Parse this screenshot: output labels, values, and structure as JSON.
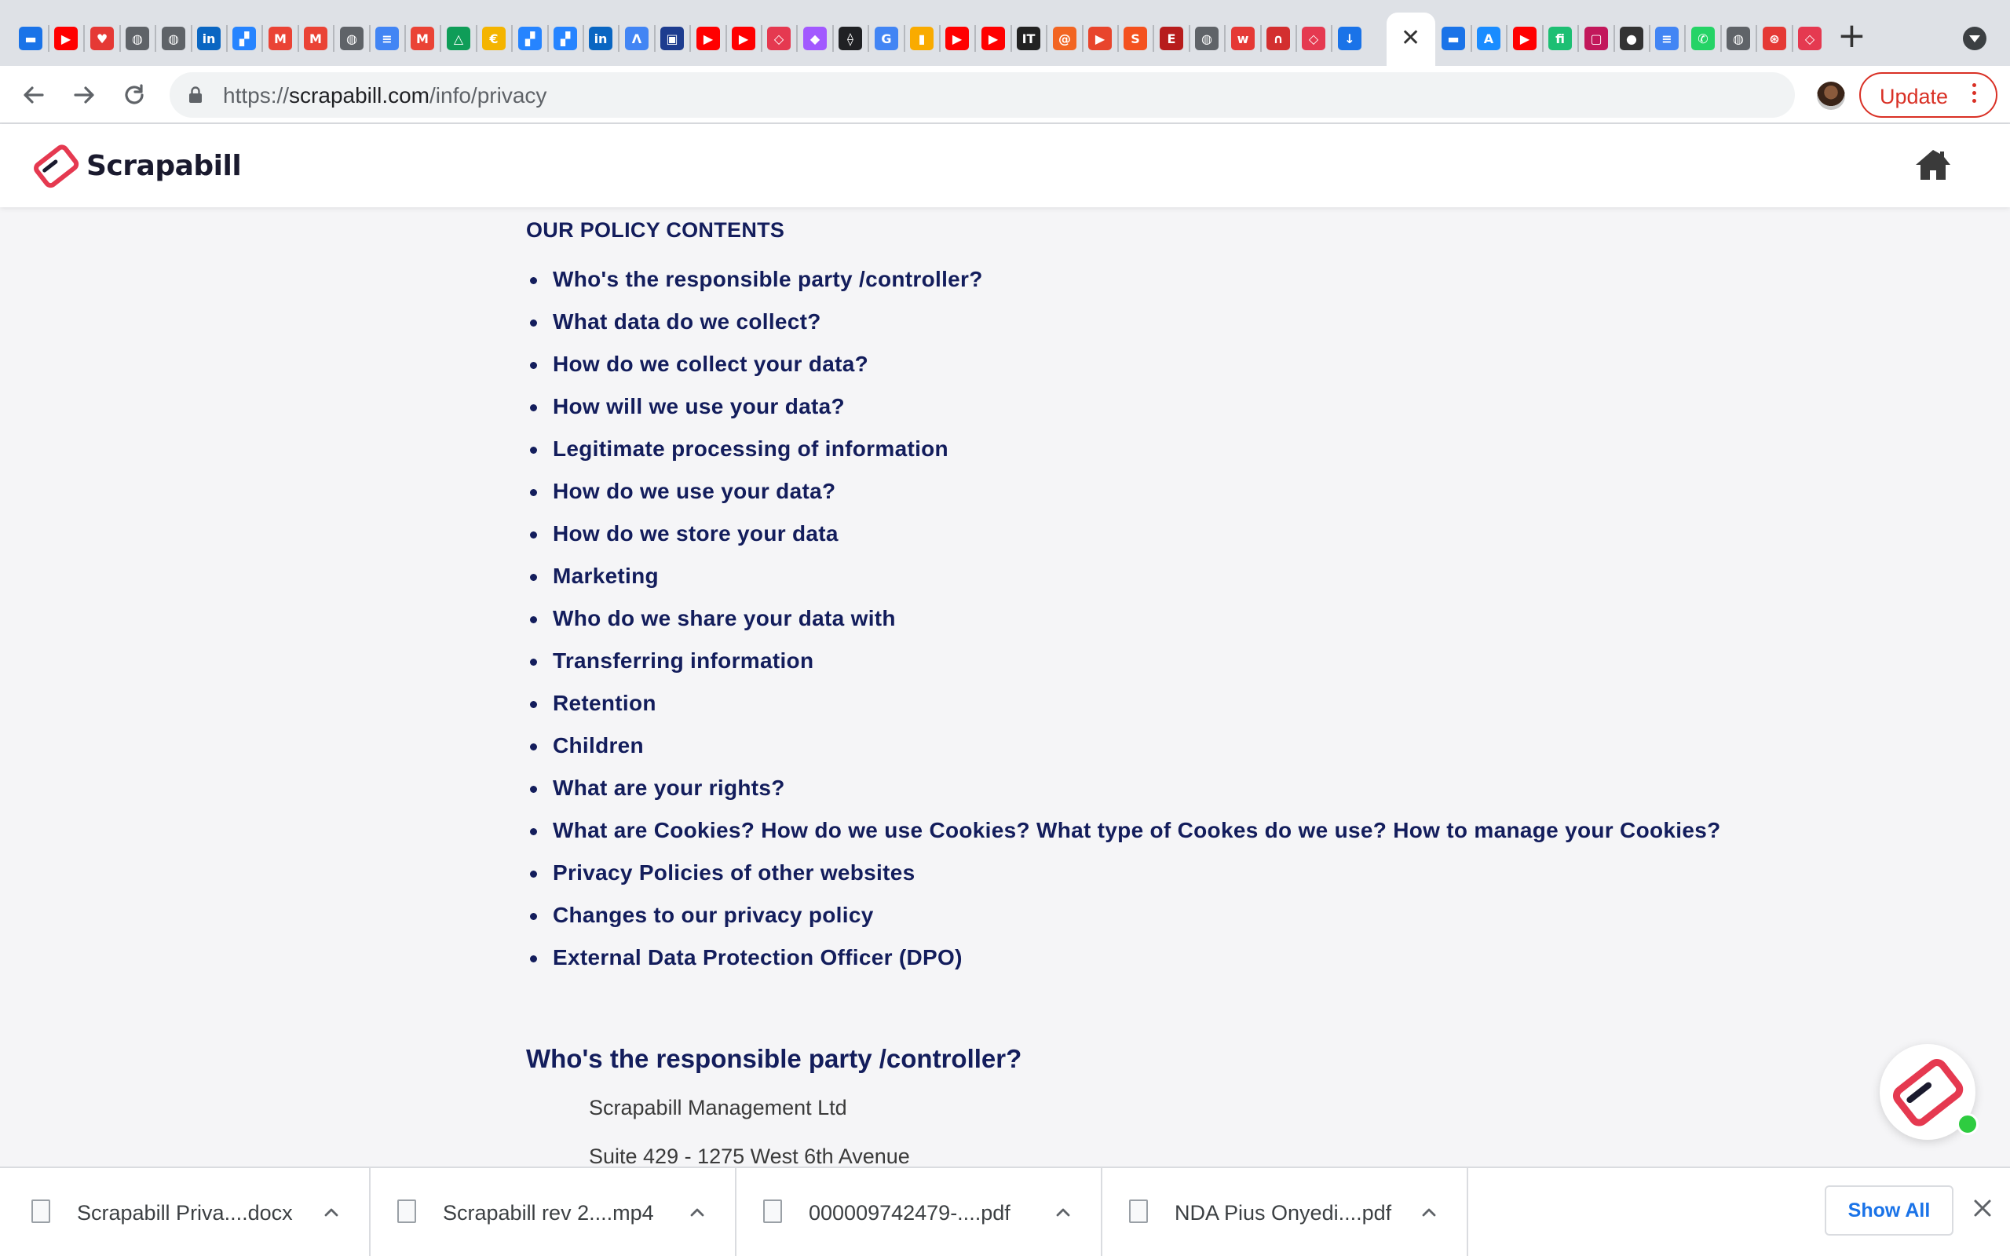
{
  "browser": {
    "tabs": [
      {
        "icon": "chat-icon",
        "color": "#1a73e8"
      },
      {
        "icon": "youtube-icon",
        "color": "#ff0000"
      },
      {
        "icon": "heart-icon",
        "color": "#e53935"
      },
      {
        "icon": "globe-icon",
        "color": "#5f6368"
      },
      {
        "icon": "globe-icon",
        "color": "#5f6368"
      },
      {
        "icon": "linkedin-icon",
        "color": "#0a66c2"
      },
      {
        "icon": "confluence-icon",
        "color": "#2684ff"
      },
      {
        "icon": "gmail-icon",
        "color": "#ea4335"
      },
      {
        "icon": "gmail-icon",
        "color": "#ea4335"
      },
      {
        "icon": "globe-icon",
        "color": "#5f6368"
      },
      {
        "icon": "document-icon",
        "color": "#4285f4"
      },
      {
        "icon": "gmail-icon",
        "color": "#ea4335"
      },
      {
        "icon": "google-drive-icon",
        "color": "#0f9d58"
      },
      {
        "icon": "coin-icon",
        "color": "#f4b400"
      },
      {
        "icon": "confluence-icon",
        "color": "#2684ff"
      },
      {
        "icon": "confluence-icon",
        "color": "#2684ff"
      },
      {
        "icon": "linkedin-icon",
        "color": "#0a66c2"
      },
      {
        "icon": "google-ads-icon",
        "color": "#4285f4"
      },
      {
        "icon": "bank-icon",
        "color": "#1d3c8f"
      },
      {
        "icon": "youtube-icon",
        "color": "#ff0000"
      },
      {
        "icon": "youtube-icon",
        "color": "#ff0000"
      },
      {
        "icon": "scrapabill-icon",
        "color": "#e53950"
      },
      {
        "icon": "figma-icon",
        "color": "#a259ff"
      },
      {
        "icon": "pen-icon",
        "color": "#202124"
      },
      {
        "icon": "google-icon",
        "color": "#4285f4"
      },
      {
        "icon": "analytics-icon",
        "color": "#f9ab00"
      },
      {
        "icon": "youtube-icon",
        "color": "#ff0000"
      },
      {
        "icon": "youtube-icon",
        "color": "#ff0000"
      },
      {
        "icon": "itpro-icon",
        "color": "#222222"
      },
      {
        "icon": "spiral-icon",
        "color": "#f26522"
      },
      {
        "icon": "bookmark-icon",
        "color": "#e8452c"
      },
      {
        "icon": "s-icon",
        "color": "#f4511e"
      },
      {
        "icon": "evs-icon",
        "color": "#b71c1c"
      },
      {
        "icon": "globe-icon",
        "color": "#5f6368"
      },
      {
        "icon": "w-icon",
        "color": "#e53935"
      },
      {
        "icon": "arc-icon",
        "color": "#d32f2f"
      },
      {
        "icon": "scrapabill-icon",
        "color": "#e53950"
      },
      {
        "icon": "download-icon",
        "color": "#1a73e8"
      },
      {
        "icon": "chat-icon",
        "color": "#1a73e8"
      },
      {
        "icon": "app-store-icon",
        "color": "#1a8cff"
      },
      {
        "icon": "youtube-icon",
        "color": "#ff0000"
      },
      {
        "icon": "fiverr-icon",
        "color": "#1dbf73"
      },
      {
        "icon": "screen-icon",
        "color": "#c2185b"
      },
      {
        "icon": "badge-icon",
        "color": "#333333"
      },
      {
        "icon": "document-icon",
        "color": "#4285f4"
      },
      {
        "icon": "whatsapp-icon",
        "color": "#25d366"
      },
      {
        "icon": "globe-icon",
        "color": "#5f6368"
      },
      {
        "icon": "target-icon",
        "color": "#e53935"
      },
      {
        "icon": "scrapabill-icon",
        "color": "#e53950"
      }
    ],
    "url_scheme": "https://",
    "url_host": "scrapabill.com",
    "url_path": "/info/privacy",
    "update_label": "Update"
  },
  "site": {
    "logo_text": "Scrapabill",
    "brand_color": "#e53950",
    "text_color": "#131d5c"
  },
  "policy": {
    "contents_heading": "OUR POLICY CONTENTS",
    "items": [
      "Who's the responsible party /controller?",
      "What data do we collect?",
      "How do we collect your data?",
      "How will we use your data?",
      "Legitimate processing of information",
      "How do we use your data?",
      "How do we store your data",
      "Marketing",
      "Who do we share your data with",
      "Transferring information",
      "Retention",
      "Children",
      "What are your rights?",
      "What are Cookies? How do we use Cookies? What type of Cookes do we use? How to manage your Cookies?",
      "Privacy Policies of other websites",
      "Changes to our privacy policy",
      "External Data Protection Officer (DPO)"
    ],
    "section_heading": "Who's the responsible party /controller?",
    "address_lines": [
      "Scrapabill Management Ltd",
      "Suite 429 - 1275 West 6th Avenue"
    ]
  },
  "downloads": {
    "items": [
      {
        "name": "Scrapabill Priva....docx",
        "icon": "word-doc-icon"
      },
      {
        "name": "Scrapabill rev 2....mp4",
        "icon": "video-file-icon"
      },
      {
        "name": "000009742479-....pdf",
        "icon": "pdf-file-icon"
      },
      {
        "name": "NDA Pius Onyedi....pdf",
        "icon": "pdf-file-icon"
      }
    ],
    "show_all_label": "Show All"
  }
}
